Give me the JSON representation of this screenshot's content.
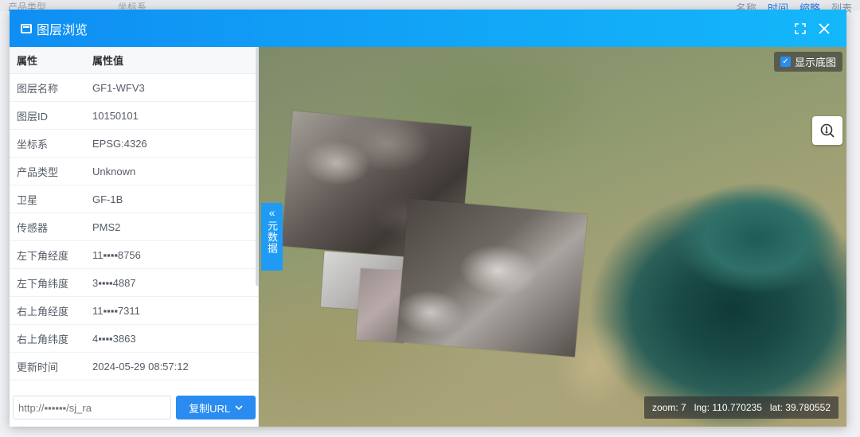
{
  "background": {
    "strip": [
      "产品类型",
      "坐标系",
      "名称",
      "时间",
      "缩略",
      "列表"
    ]
  },
  "modal": {
    "title": "图层浏览"
  },
  "attributes": {
    "header_key": "属性",
    "header_value": "属性值",
    "rows": [
      {
        "key": "图层名称",
        "value": "GF1-WFV3"
      },
      {
        "key": "图层ID",
        "value": "10150101"
      },
      {
        "key": "坐标系",
        "value": "EPSG:4326"
      },
      {
        "key": "产品类型",
        "value": "Unknown"
      },
      {
        "key": "卫星",
        "value": "GF-1B"
      },
      {
        "key": "传感器",
        "value": "PMS2"
      },
      {
        "key": "左下角经度",
        "value": "11▪▪▪▪8756"
      },
      {
        "key": "左下角纬度",
        "value": "3▪▪▪▪4887"
      },
      {
        "key": "右上角经度",
        "value": "11▪▪▪▪7311"
      },
      {
        "key": "右上角纬度",
        "value": "4▪▪▪▪3863"
      },
      {
        "key": "更新时间",
        "value": "2024-05-29 08:57:12"
      }
    ]
  },
  "url_bar": {
    "value": "http://▪▪▪▪▪▪/sj_ra",
    "copy_label": "复制URL"
  },
  "collapse_tab": {
    "label": "元数据"
  },
  "map": {
    "basemap_label": "显示底图",
    "status": {
      "zoom": "zoom:  7",
      "lng": "lng:  110.770235",
      "lat": "lat:  39.780552"
    }
  },
  "colors": {
    "header": "#12a8f7",
    "button": "#2a8cf0",
    "sea": "#1b4b47"
  }
}
